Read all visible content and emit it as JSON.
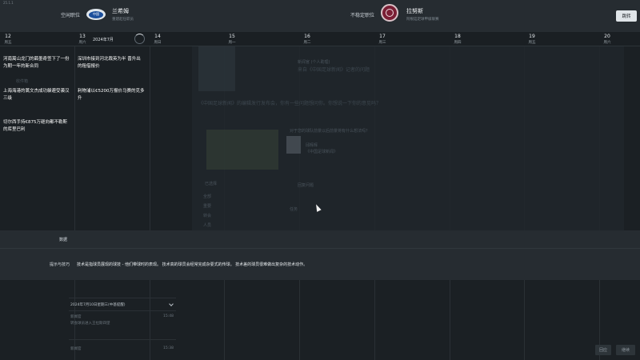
{
  "app": {
    "version": "25.1.1"
  },
  "header": {
    "left_club": {
      "role": "空闲职位",
      "badge_text": "中国",
      "name": "兰希姆",
      "subtitle": "重建起任职员"
    },
    "right_club": {
      "role": "不稳定职位",
      "name": "拉努斯",
      "subtitle": "阿根廷足球甲级联赛"
    },
    "skip_label": "跳转"
  },
  "calendar": {
    "month": "2024年7月",
    "days": [
      {
        "num": "12",
        "dow": "周五"
      },
      {
        "num": "13",
        "dow": "周六"
      },
      {
        "num": "14",
        "dow": "周日"
      },
      {
        "num": "15",
        "dow": "周一"
      },
      {
        "num": "16",
        "dow": "周二"
      },
      {
        "num": "17",
        "dow": "周三"
      },
      {
        "num": "18",
        "dow": "周四"
      },
      {
        "num": "19",
        "dow": "周五"
      },
      {
        "num": "20",
        "dow": "周六"
      }
    ]
  },
  "news": {
    "col1": [
      "河南嵩山龙门的薛墨奇签下了一份为期一年的新合同",
      "上海海港的蒿文杰成功躲避受袭汉三级",
      "切尔西手持€875万砸向都不勒斯的库里巴利"
    ],
    "col2": [
      "深圳市接到河北裁英为半 晋升出的租借报价",
      "利物浦以€5200万报价马赛的克多升"
    ]
  },
  "background": {
    "sender": "新闻官 (个人助理)",
    "headline": "来自《中国足球新闻》记者的问题",
    "question": "《中国足球新闻》的编辑发行发布会，你有一些问题想问你。你想说一下你的意见吗？",
    "q2": "对于您的球队前景以后前景将有什么想法吗？",
    "person": "邱辉辉",
    "person_role": "《中国足球新闻》",
    "left_labels": [
      "全部",
      "重要",
      "转会",
      "人员",
      "任务"
    ],
    "tag": "已选择",
    "reply": "回复问题",
    "inbox": "收件箱"
  },
  "band": {
    "label_data": "数据",
    "label_skill": "提示与技巧",
    "tip": "技术是指球员展现的球技 - 他们带球时的表现。 技术高的球员会经常完成杂耍式的传球。 技术差的球员很难做出复杂的技术动作。"
  },
  "lower": {
    "section_title": "2024年7月10日星期三(中基提醒)",
    "items": [
      {
        "sender": "新闻官",
        "text": "转会球员进入王拉斯四望",
        "time": "15:48"
      },
      {
        "sender": "新闻官",
        "text": "",
        "time": "15:38"
      }
    ]
  },
  "footer": {
    "btn_a": "回应",
    "btn_b": "继续"
  }
}
